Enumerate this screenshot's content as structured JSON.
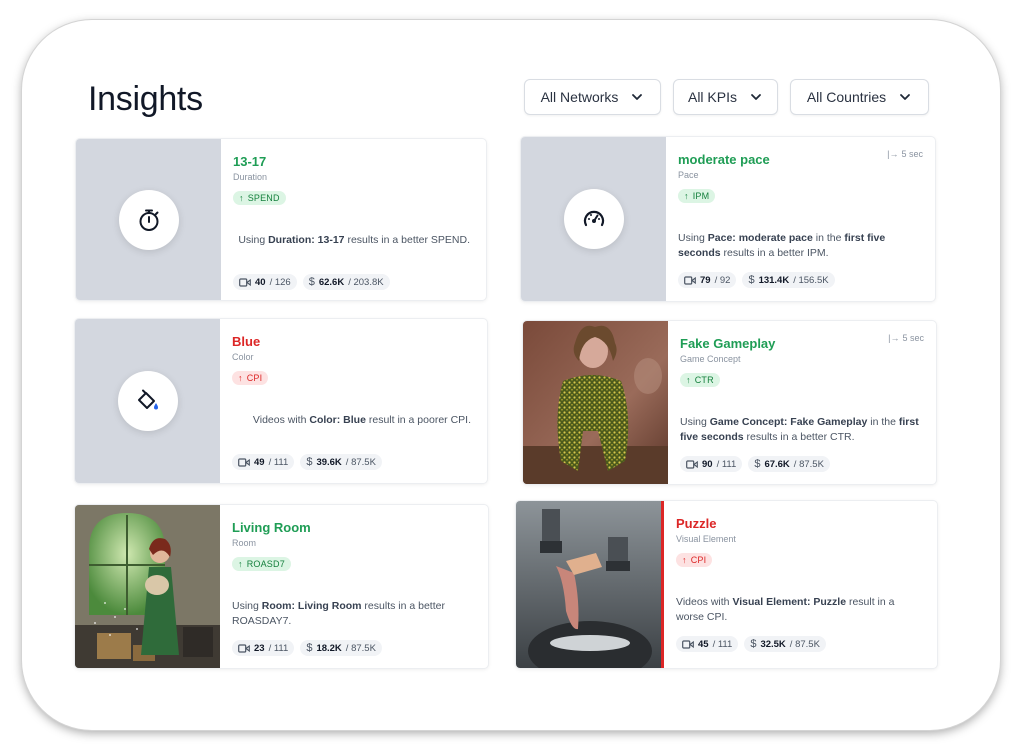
{
  "page": {
    "title": "Insights"
  },
  "filters": [
    {
      "label": "All Networks"
    },
    {
      "label": "All KPIs"
    },
    {
      "label": "All Countries"
    }
  ],
  "cards": [
    {
      "name": "13-17",
      "category": "Duration",
      "kpi": "SPEND",
      "direction": "up",
      "tone": "good",
      "desc": [
        {
          "t": "Using ",
          "b": false
        },
        {
          "t": "Duration: 13-17",
          "b": true
        },
        {
          "t": " results in a better SPEND.",
          "b": false
        }
      ],
      "videos": "40",
      "videos_total": "/ 126",
      "spend": "62.6K",
      "spend_total": "/ 203.8K",
      "thumb_icon": "stopwatch-icon"
    },
    {
      "name": "moderate pace",
      "category": "Pace",
      "kpi": "IPM",
      "direction": "up",
      "tone": "good",
      "duration_note": "5 sec",
      "desc": [
        {
          "t": "Using ",
          "b": false
        },
        {
          "t": "Pace: moderate pace",
          "b": true
        },
        {
          "t": " in the ",
          "b": false
        },
        {
          "t": "first five seconds",
          "b": true
        },
        {
          "t": " results in a better IPM.",
          "b": false
        }
      ],
      "videos": "79",
      "videos_total": "/ 92",
      "spend": "131.4K",
      "spend_total": "/ 156.5K",
      "thumb_icon": "speedometer-icon"
    },
    {
      "name": "Blue",
      "category": "Color",
      "kpi": "CPI",
      "direction": "up",
      "tone": "bad",
      "desc": [
        {
          "t": "Videos with ",
          "b": false
        },
        {
          "t": "Color: Blue",
          "b": true
        },
        {
          "t": " result in a poorer CPI.",
          "b": false
        }
      ],
      "videos": "49",
      "videos_total": "/ 111",
      "spend": "39.6K",
      "spend_total": "/ 87.5K",
      "thumb_icon": "paint-bucket-icon"
    },
    {
      "name": "Fake Gameplay",
      "category": "Game Concept",
      "kpi": "CTR",
      "direction": "up",
      "tone": "good",
      "duration_note": "5 sec",
      "desc": [
        {
          "t": "Using ",
          "b": false
        },
        {
          "t": "Game Concept: Fake Gameplay",
          "b": true
        },
        {
          "t": " in the ",
          "b": false
        },
        {
          "t": "first five seconds",
          "b": true
        },
        {
          "t": " results in a better CTR.",
          "b": false
        }
      ],
      "videos": "90",
      "videos_total": "/ 111",
      "spend": "67.6K",
      "spend_total": "/ 87.5K",
      "thumb_icon": "video-thumbnail"
    },
    {
      "name": "Living Room",
      "category": "Room",
      "kpi": "ROASD7",
      "direction": "up",
      "tone": "good",
      "desc": [
        {
          "t": "Using ",
          "b": false
        },
        {
          "t": "Room: Living Room",
          "b": true
        },
        {
          "t": " results in a better ROASDAY7.",
          "b": false
        }
      ],
      "videos": "23",
      "videos_total": "/ 111",
      "spend": "18.2K",
      "spend_total": "/ 87.5K",
      "thumb_icon": "video-thumbnail"
    },
    {
      "name": "Puzzle",
      "category": "Visual Element",
      "kpi": "CPI",
      "direction": "up",
      "tone": "bad",
      "desc": [
        {
          "t": "Videos with ",
          "b": false
        },
        {
          "t": "Visual Element: Puzzle",
          "b": true
        },
        {
          "t": " result in a worse CPI.",
          "b": false
        }
      ],
      "videos": "45",
      "videos_total": "/ 111",
      "spend": "32.5K",
      "spend_total": "/ 87.5K",
      "thumb_icon": "video-thumbnail"
    }
  ],
  "colors": {
    "good": "#1f9d55",
    "bad": "#dc2626",
    "thumb_bg": "#d3d7df"
  }
}
